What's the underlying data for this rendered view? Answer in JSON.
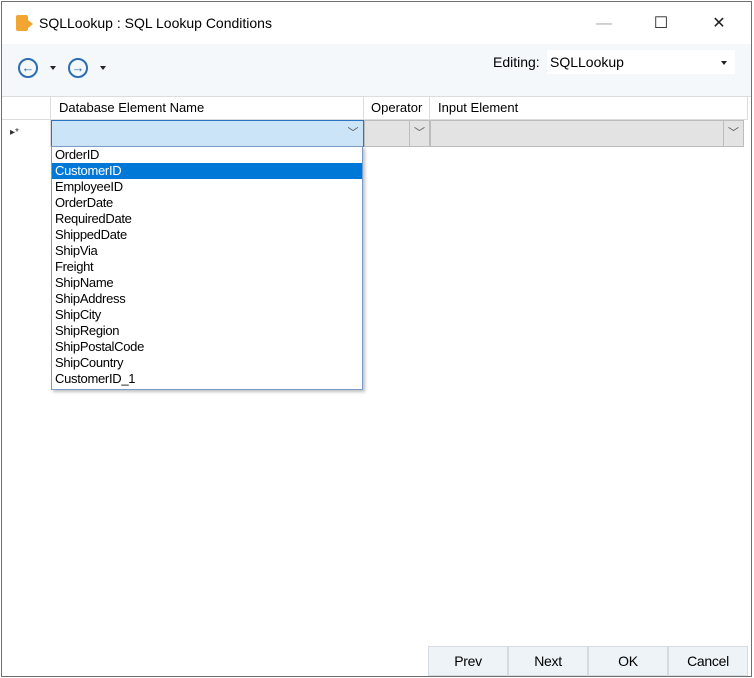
{
  "window": {
    "title": "SQLLookup : SQL Lookup Conditions",
    "minimize": "—",
    "maximize": "☐",
    "close": "✕"
  },
  "toolbar": {
    "back_icon": "←",
    "forward_icon": "→",
    "editing_label": "Editing:",
    "editing_value": "SQLLookup"
  },
  "grid": {
    "columns": [
      "Database Element Name",
      "Operator",
      "Input Element"
    ],
    "new_row_marker": "▸*"
  },
  "dropdown": {
    "selected": "CustomerID",
    "items": [
      "OrderID",
      "CustomerID",
      "EmployeeID",
      "OrderDate",
      "RequiredDate",
      "ShippedDate",
      "ShipVia",
      "Freight",
      "ShipName",
      "ShipAddress",
      "ShipCity",
      "ShipRegion",
      "ShipPostalCode",
      "ShipCountry",
      "CustomerID_1"
    ]
  },
  "buttons": {
    "prev": "Prev",
    "next": "Next",
    "ok": "OK",
    "cancel": "Cancel"
  }
}
